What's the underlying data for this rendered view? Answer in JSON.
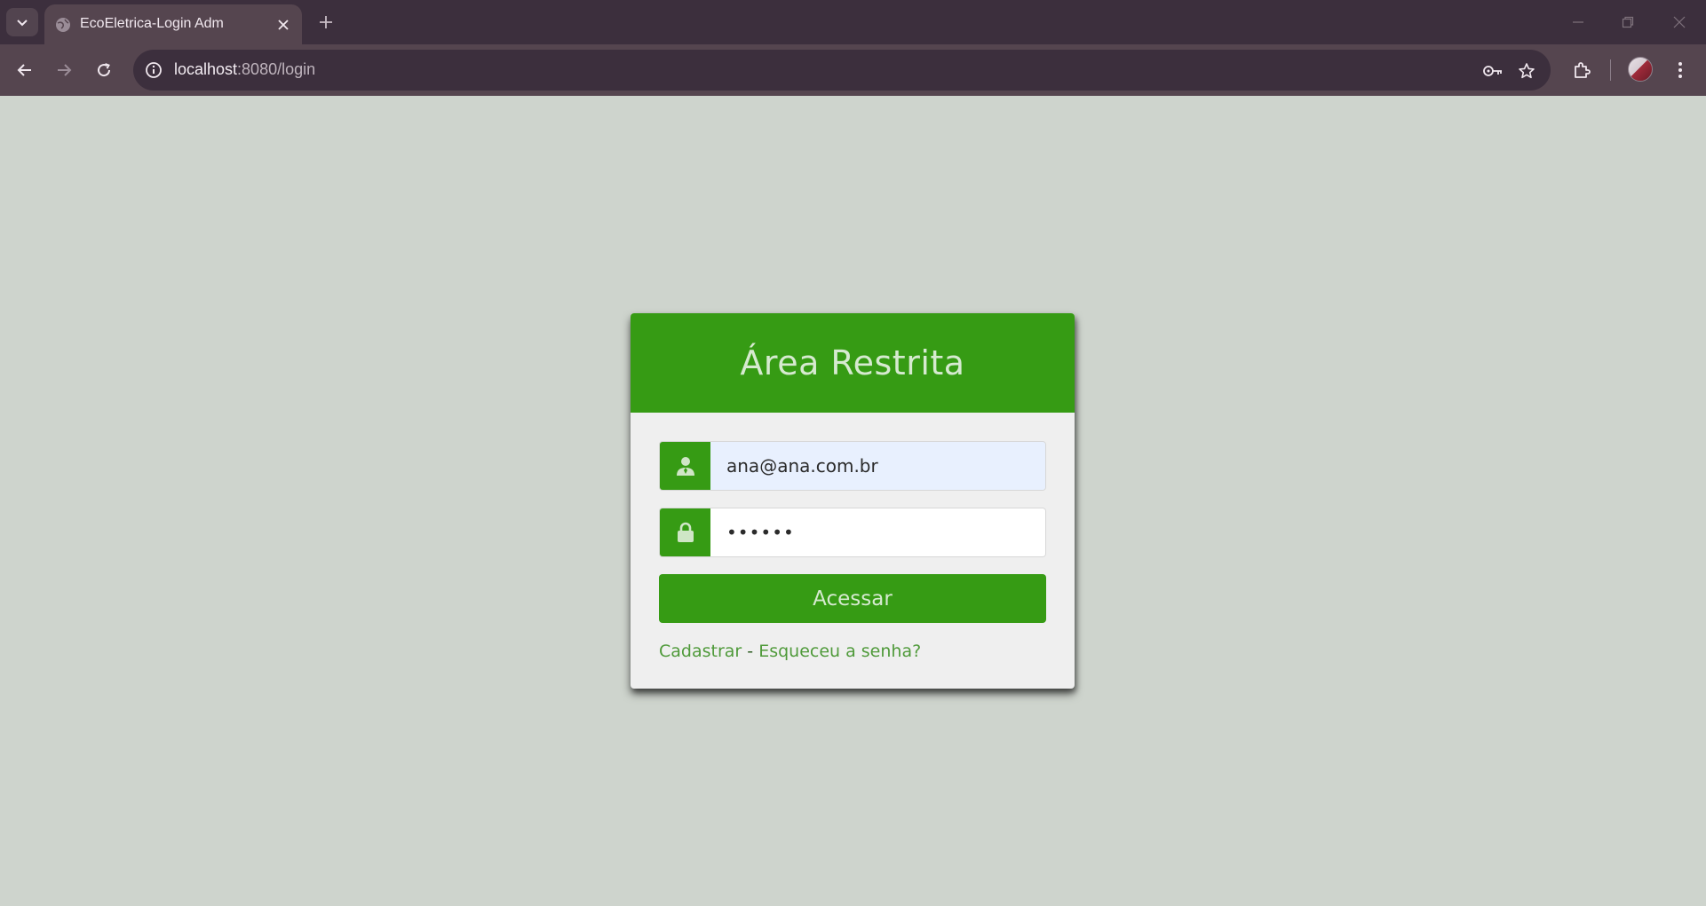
{
  "browser": {
    "tab": {
      "title": "EcoEletrica-Login Adm"
    },
    "address": {
      "host": "localhost",
      "path": ":8080/login"
    }
  },
  "login": {
    "title": "Área Restrita",
    "email_value": "ana@ana.com.br",
    "password_mask": "••••••",
    "submit_label": "Acessar",
    "register_link": "Cadastrar",
    "separator": "-",
    "forgot_link": "Esqueceu a senha?"
  },
  "colors": {
    "primary_green": "#369b14",
    "page_background": "#ced4cd",
    "card_background": "#efefef",
    "browser_frame": "#3c2f3d"
  },
  "icons": {
    "email_addon": "user-icon",
    "password_addon": "lock-icon"
  }
}
